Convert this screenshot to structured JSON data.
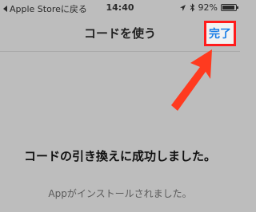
{
  "status_bar": {
    "back_label": "Apple Storeに戻る",
    "time": "14:40",
    "location_icon": "location-arrow-icon",
    "bluetooth_icon": "bluetooth-icon",
    "battery_percent_label": "92%",
    "battery_level": 0.92
  },
  "nav": {
    "title": "コードを使う",
    "done_label": "完了"
  },
  "annotation": {
    "arrow_color": "#ff3a1f",
    "highlight_color": "#ff1c1c"
  },
  "content": {
    "success_title": "コードの引き換えに成功しました。",
    "success_subtitle": "Appがインストールされました。"
  }
}
